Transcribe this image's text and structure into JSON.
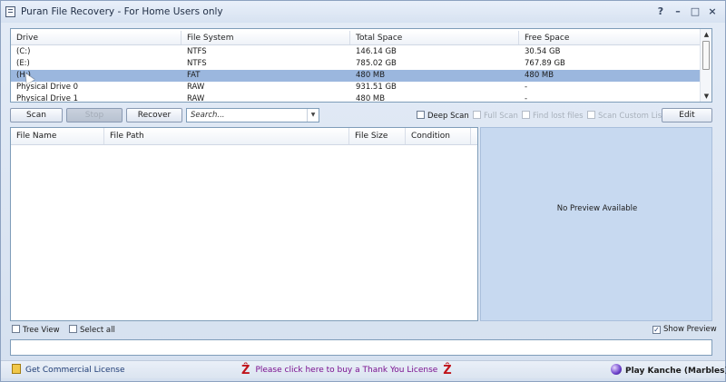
{
  "window": {
    "title": "Puran File Recovery - For Home Users only",
    "help_label": "?",
    "minimize_label": "–",
    "maximize_label": "□",
    "close_label": "×"
  },
  "drives": {
    "columns": [
      "Drive",
      "File System",
      "Total Space",
      "Free Space"
    ],
    "rows": [
      {
        "drive": "(C:)",
        "fs": "NTFS",
        "total": "146.14 GB",
        "free": "30.54 GB",
        "selected": false
      },
      {
        "drive": "(E:)",
        "fs": "NTFS",
        "total": "785.02 GB",
        "free": "767.89 GB",
        "selected": false
      },
      {
        "drive": "(H:)",
        "fs": "FAT",
        "total": "480 MB",
        "free": "480 MB",
        "selected": true
      },
      {
        "drive": "Physical Drive 0",
        "fs": "RAW",
        "total": "931.51 GB",
        "free": "-",
        "selected": false
      },
      {
        "drive": "Physical Drive 1",
        "fs": "RAW",
        "total": "480 MB",
        "free": "-",
        "selected": false
      }
    ]
  },
  "toolbar": {
    "scan_label": "Scan",
    "stop_label": "Stop",
    "recover_label": "Recover",
    "search_placeholder": "Search...",
    "deep_scan_label": "Deep Scan",
    "full_scan_label": "Full Scan",
    "find_lost_files_label": "Find lost files",
    "scan_custom_list_label": "Scan Custom List",
    "edit_label": "Edit"
  },
  "files": {
    "columns": [
      "File Name",
      "File Path",
      "File Size",
      "Condition"
    ]
  },
  "preview": {
    "message": "No Preview Available"
  },
  "options": {
    "tree_view_label": "Tree View",
    "select_all_label": "Select all",
    "show_preview_label": "Show Preview",
    "show_preview_checked": true
  },
  "footer": {
    "commercial_license": "Get Commercial License",
    "thank_you_license": "Please click here to buy a Thank You License",
    "play_game": "Play Kanche (Marbles)"
  }
}
